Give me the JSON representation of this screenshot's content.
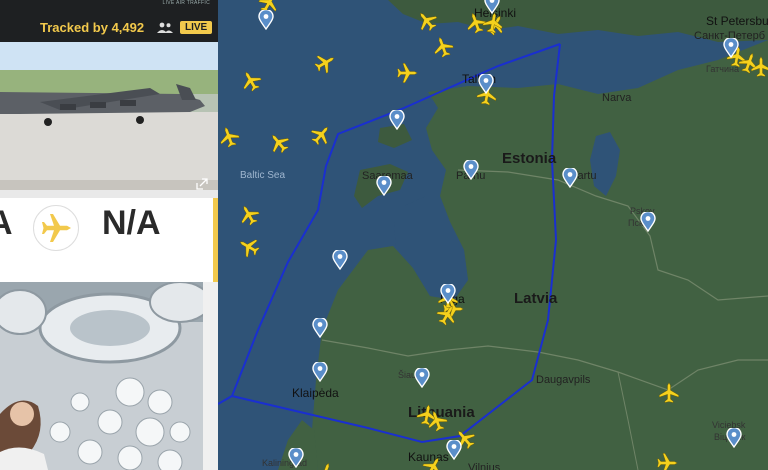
{
  "sidebar": {
    "tracked_label": "Tracked by",
    "tracked_count": "4,492",
    "live_badge": "LIVE",
    "brand_caption": "LIVE AIR TRAFFIC",
    "origin_code": "A",
    "destination_code": "N/A",
    "icons": [
      "people-icon",
      "airplane-icon",
      "expand-icon"
    ],
    "accent": "#f2c94c"
  },
  "map": {
    "countries": {
      "estonia": "Estonia",
      "latvia": "Latvia",
      "lithuania": "Lithuania"
    },
    "cities": {
      "helsinki": "Helsinki",
      "st_petersburg": "St Petersbu",
      "st_petersburg_cyr": "Санкт-Петерб",
      "gatchina": "Гатчина",
      "tallinn": "Tallinn",
      "narva": "Narva",
      "saaremaa": "Saaremaa",
      "parnu": "Pärnu",
      "tartu": "Tartu",
      "pskov": "Pskov",
      "pskov_cyr": "Псков",
      "riga": "Riga",
      "daugavpils": "Daugavpils",
      "siauliai": "Šiauliai",
      "klaipeda": "Klaipėda",
      "kaunas": "Kaunas",
      "vilnius": "Vilnius",
      "viciebsk": "Viciebsk",
      "viciebsk_cyr": "Віцебск",
      "kaliningrad": "Kaliningrad"
    },
    "sea": "Baltic Sea",
    "route_color": "#1a2fd0",
    "plane_color": "#f5d11d",
    "pin_color": "#5a8ec9"
  }
}
